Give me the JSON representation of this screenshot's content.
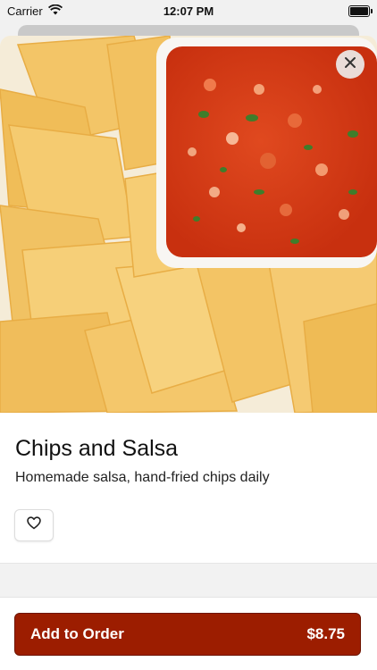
{
  "status_bar": {
    "carrier": "Carrier",
    "time": "12:07 PM"
  },
  "item": {
    "title": "Chips and Salsa",
    "description": "Homemade salsa, hand-fried chips daily"
  },
  "actions": {
    "add_label": "Add to Order",
    "price": "$8.75"
  },
  "icons": {
    "close": "close-icon",
    "favorite": "heart-icon",
    "wifi": "wifi-icon",
    "battery": "battery-icon"
  },
  "colors": {
    "primary_button": "#9c1d00",
    "salsa": "#d63b16",
    "chip": "#f1c15e"
  }
}
